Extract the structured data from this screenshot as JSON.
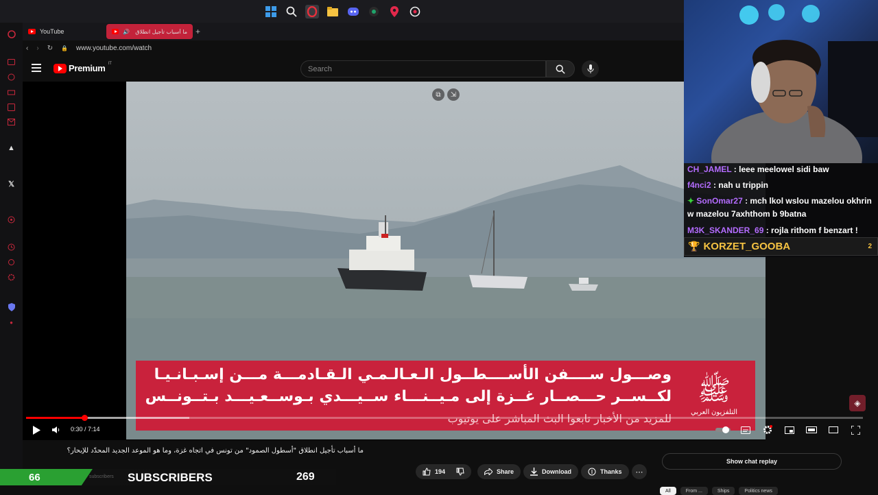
{
  "taskbar": {
    "icons": [
      "windows-logo-icon",
      "search-icon",
      "opera-icon",
      "file-explorer-icon",
      "discord-icon",
      "obs-icon",
      "location-pin-icon",
      "opera-gx-icon"
    ]
  },
  "browser": {
    "tabs": [
      {
        "label": "YouTube",
        "active": false
      },
      {
        "label": "ما أسباب تأجيل انطلاق \"",
        "active": true
      }
    ],
    "address": "www.youtube.com/watch"
  },
  "youtube": {
    "logo_text": "Premium",
    "logo_sup": "IT",
    "search_placeholder": "Search"
  },
  "video": {
    "banner_line1": "وصـــول ســــفن الأســــطــول الـعـالـمـي الـقـادمـــة مـــن إسـبـانـيـا",
    "banner_line2": "لكــســر حـــصــار غــزة إلى مـيــنـــاء ســيـــدي بـوســعـيـــد بـتــونــس",
    "banner_line3": "للمزيد من الأخبار تابعوا البث المباشر على يوتيوب",
    "channel_logo_mark": "ﷺ",
    "channel_name": "التلفزيون العربي",
    "time_current": "0:30",
    "time_total": "7:14",
    "time_display": "0:30 / 7:14",
    "progress_fraction": 0.07
  },
  "below_video": {
    "title": "ما أسباب تأجيل انطلاق \"أسطول الصمود\" من تونس في اتجاه غزة، وما هو الموعد الجديد المحدّد للإبحار؟",
    "likes": "194",
    "share_label": "Share",
    "download_label": "Download",
    "thanks_label": "Thanks",
    "chat_replay_label": "Show chat replay",
    "subscribers_ghost": "subscribers"
  },
  "chat": {
    "messages": [
      {
        "user": "CH_JAMEL",
        "text": " : leee meelowel sidi baw",
        "color": "#b46cff"
      },
      {
        "user": "f4nci2",
        "text": " : nah u trippin",
        "color": "#b46cff"
      },
      {
        "user": "SonOmar27",
        "text": " : mch lkol wslou mazelou okhrin",
        "color": "#b46cff"
      },
      {
        "user": "",
        "text": "w mazelou 7axhthom b 9batna",
        "color": "#ffffff"
      },
      {
        "user": "M3K_SKANDER_69",
        "text": " : rojla rithom f benzart !",
        "color": "#b46cff"
      }
    ],
    "top_subscriber": "KORZET_GOOBA",
    "top_subscriber_rank": "2"
  },
  "overlay": {
    "subscriber_count": "66",
    "label": "SUBSCRIBERS",
    "goal": "269"
  },
  "chips": [
    "All",
    "From ...",
    "Ships",
    "Politics news"
  ],
  "colors": {
    "accent": "#ff0000",
    "opera_red": "#c3223a",
    "news_banner": "#c9223c",
    "sub_green": "#2aa032",
    "chat_user": "#b46cff"
  }
}
